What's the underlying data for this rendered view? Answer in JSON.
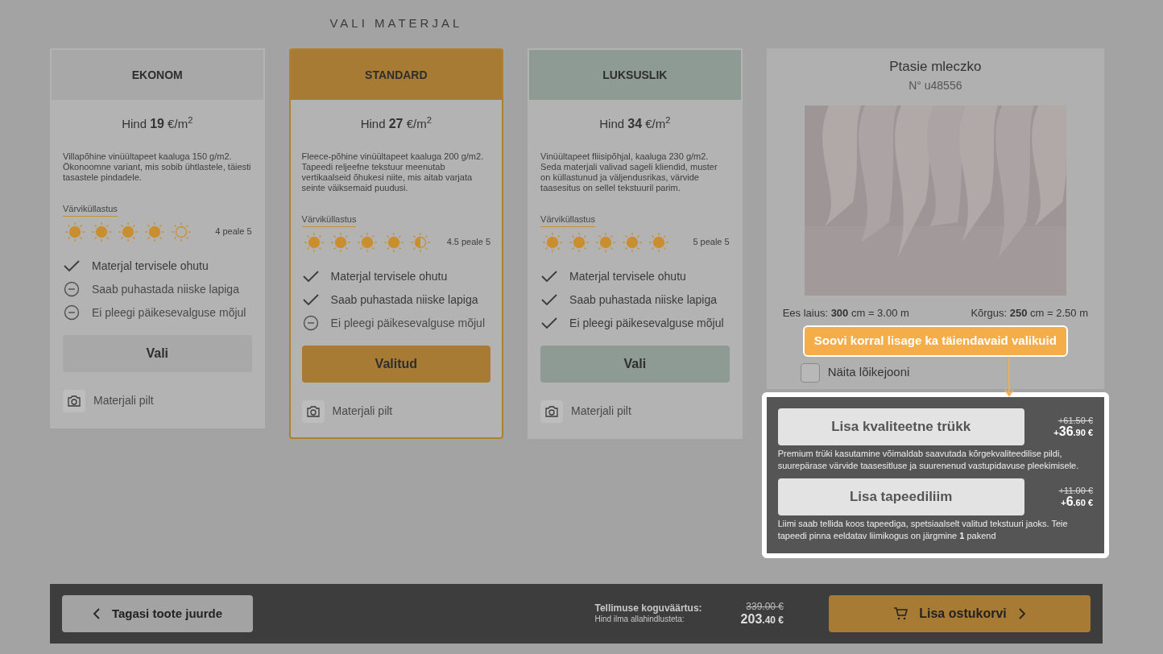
{
  "page_title": "VALI MATERJAL",
  "materials": [
    {
      "name": "EKONOM",
      "color": "#a8a8a8",
      "selected": false,
      "price": "Hind **19** €/m$^{2}$",
      "description": "Villapõhine vinüültapeet kaaluga 150 g/m2. Ökonoomne variant, mis sobib ühtlastele, täiesti tasastele pindadele.",
      "saturation_label": "Värviküllastus",
      "stars": 4,
      "rating": "4 peale 5",
      "features": [
        {
          "label": "Materjal tervisele ohutu",
          "available": true
        },
        {
          "label": "Saab puhastada niiske lapiga",
          "available": false
        },
        {
          "label": "Ei pleegi päikesevalguse mõjul",
          "available": false
        }
      ],
      "button": "Vali",
      "photo_label": "Materjali pilt"
    },
    {
      "name": "STANDARD",
      "color": "#a87b35",
      "selected": true,
      "price": "Hind **27** €/m$^{2}$",
      "description": "Fleece-põhine vinüültapeet kaaluga 200 g/m2. Tapeedi reljeefne tekstuur meenutab vertikaalseid õhukesi niite, mis aitab varjata seinte väiksemaid puudusi.",
      "saturation_label": "Värviküllastus",
      "stars": 4.5,
      "rating": "4.5 peale 5",
      "features": [
        {
          "label": "Materjal tervisele ohutu",
          "available": true
        },
        {
          "label": "Saab puhastada niiske lapiga",
          "available": true
        },
        {
          "label": "Ei pleegi päikesevalguse mõjul",
          "available": false
        }
      ],
      "button": "Valitud",
      "photo_label": "Materjali pilt"
    },
    {
      "name": "LUKSUSLIK",
      "color": "#8e9a94",
      "selected": false,
      "price": "Hind **34** €/m$^{2}$",
      "description": "Vinüültapeet fliisipõhjal, kaaluga 230 g/m2. Seda materjali valivad sageli kliendid, muster on küllastunud ja väljendusrikas, värvide taasesitus on sellel tekstuuril parim.",
      "saturation_label": "Värviküllastus",
      "stars": 5,
      "rating": "5 peale 5",
      "features": [
        {
          "label": "Materjal tervisele ohutu",
          "available": true
        },
        {
          "label": "Saab puhastada niiske lapiga",
          "available": true
        },
        {
          "label": "Ei pleegi päikesevalguse mõjul",
          "available": true
        }
      ],
      "button": "Vali",
      "photo_label": "Materjali pilt"
    }
  ],
  "product": {
    "title": "Ptasie mleczko",
    "number": "N° u48556",
    "width": "Ees laius: **300** cm = 3.00 m",
    "height": "Kõrgus: **250** cm = 2.50 m",
    "cut_lines": {
      "label": "Näita lõikejooni",
      "checked": false
    }
  },
  "tooltip": "Soovi korral lisage ka täiendavaid valikuid",
  "options": [
    {
      "button": "Lisa kvaliteetne trükk",
      "old_price": "+61.50 €",
      "price": "+**36**.90 €",
      "description": "Premium trüki kasutamine võimaldab saavutada kõrgekvaliteedilise pildi, suurepärase värvide taasesitluse ja suurenenud vastupidavuse pleekimisele."
    },
    {
      "button": "Lisa tapeediliim",
      "old_price": "+11.00 €",
      "price": "+**6**.60 €",
      "description": "Liimi saab tellida koos tapeediga, spetsiaalselt valitud tekstuuri jaoks. Teie tapeedi pinna eeldatav liimikogus on järgmine **1** pakend"
    }
  ],
  "footer": {
    "back_button": "Tagasi toote juurde",
    "total_label": "Tellimuse koguväärtus:",
    "total_sublabel": "Hind ilma allahindlusteta:",
    "old_total": "339.00 €",
    "total": "**203**.40 €",
    "cart_button": "Lisa ostukorvi"
  }
}
